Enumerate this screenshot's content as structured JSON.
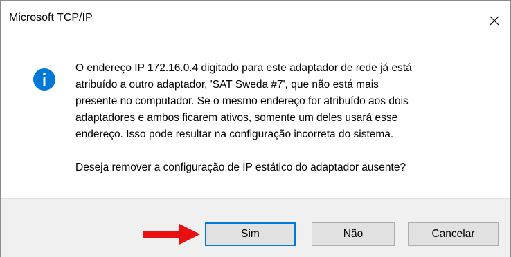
{
  "window": {
    "title": "Microsoft TCP/IP",
    "close_glyph": "✕"
  },
  "icon": {
    "type": "info-icon",
    "glyph": "i",
    "color": "#0078d7"
  },
  "message": {
    "paragraph1_line1": "O endereço IP 172.16.0.4 digitado para este adaptador de rede já está",
    "paragraph1_line2": "atribuído a outro adaptador, 'SAT Sweda #7', que não está mais",
    "paragraph1_line3": "presente no computador. Se o mesmo endereço for atribuído aos dois",
    "paragraph1_line4": "adaptadores e ambos ficarem ativos, somente um deles usará esse",
    "paragraph1_line5": "endereço. Isso pode resultar na configuração incorreta do sistema.",
    "paragraph2": "Deseja remover a configuração de IP estático do adaptador ausente?"
  },
  "buttons": {
    "yes": "Sim",
    "no": "Não",
    "cancel": "Cancelar"
  },
  "annotation": {
    "type": "red-arrow",
    "color": "#e81010"
  },
  "colors": {
    "footer_bg": "#f0f0f0",
    "button_bg": "#e1e1e1",
    "focus_border": "#0078d7"
  }
}
